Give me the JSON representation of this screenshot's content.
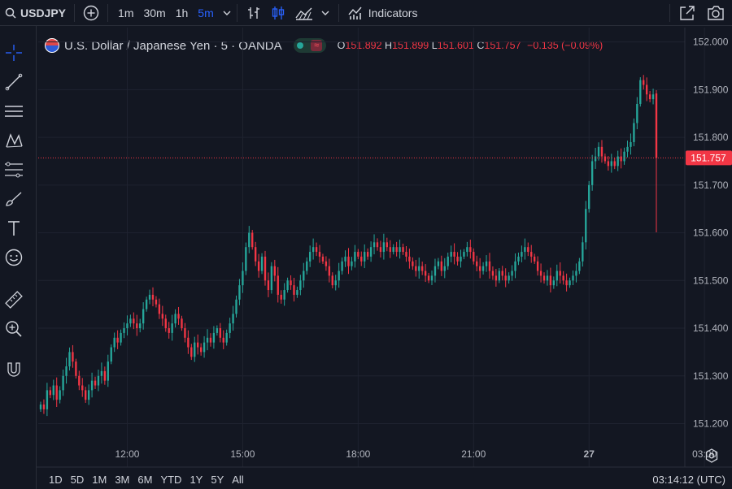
{
  "toolbar": {
    "symbol": "USDJPY",
    "timeframes": [
      "1m",
      "30m",
      "1h",
      "5m"
    ],
    "active_timeframe": "5m",
    "indicators_label": "Indicators"
  },
  "legend": {
    "title": "U.S. Dollar / Japanese Yen · 5 · OANDA",
    "o_key": "O",
    "o_val": "151.892",
    "h_key": "H",
    "h_val": "151.899",
    "l_key": "L",
    "l_val": "151.601",
    "c_key": "C",
    "c_val": "151.757",
    "change": "−0.135 (−0.09%)"
  },
  "bottom": {
    "ranges": [
      "1D",
      "5D",
      "1M",
      "3M",
      "6M",
      "YTD",
      "1Y",
      "5Y",
      "All"
    ],
    "clock": "03:14:12 (UTC)"
  },
  "colors": {
    "up": "#26a69a",
    "down": "#f23645",
    "accent": "#2962ff",
    "background": "#131722",
    "grid": "#1f2330"
  },
  "chart_data": {
    "type": "candlestick",
    "ylim": [
      151.16,
      152.03
    ],
    "y_ticks": [
      151.2,
      151.3,
      151.4,
      151.5,
      151.6,
      151.7,
      151.8,
      151.9,
      152.0
    ],
    "y_tick_labels": [
      "151.200",
      "151.300",
      "151.400",
      "151.500",
      "151.600",
      "151.700",
      "151.800",
      "151.900",
      "152.000"
    ],
    "x_ticks": [
      {
        "label": "12:00",
        "index": 27
      },
      {
        "label": "15:00",
        "index": 63
      },
      {
        "label": "18:00",
        "index": 99
      },
      {
        "label": "21:00",
        "index": 135
      },
      {
        "label": "27",
        "index": 171
      },
      {
        "label": "03:00",
        "index": 207
      }
    ],
    "last_price": 151.757,
    "last_price_label": "151.757",
    "close": [
      151.24,
      151.23,
      151.27,
      151.26,
      151.28,
      151.25,
      151.27,
      151.3,
      151.32,
      151.35,
      151.33,
      151.3,
      151.28,
      151.27,
      151.25,
      151.27,
      151.29,
      151.28,
      151.3,
      151.31,
      151.29,
      151.33,
      151.36,
      151.38,
      151.37,
      151.39,
      151.4,
      151.41,
      151.42,
      151.41,
      151.4,
      151.41,
      151.44,
      151.46,
      151.47,
      151.46,
      151.45,
      151.43,
      151.42,
      151.4,
      151.39,
      151.41,
      151.43,
      151.42,
      151.4,
      151.38,
      151.36,
      151.34,
      151.37,
      151.36,
      151.35,
      151.37,
      151.38,
      151.37,
      151.39,
      151.4,
      151.38,
      151.37,
      151.39,
      151.41,
      151.43,
      151.46,
      151.49,
      151.52,
      151.57,
      151.6,
      151.57,
      151.54,
      151.52,
      151.55,
      151.5,
      151.48,
      151.53,
      151.51,
      151.47,
      151.46,
      151.48,
      151.5,
      151.49,
      151.47,
      151.48,
      151.5,
      151.52,
      151.54,
      151.56,
      151.57,
      151.56,
      151.55,
      151.54,
      151.53,
      151.51,
      151.49,
      151.5,
      151.52,
      151.54,
      151.55,
      151.53,
      151.54,
      151.56,
      151.55,
      151.54,
      151.56,
      151.55,
      151.57,
      151.58,
      151.57,
      151.56,
      151.58,
      151.57,
      151.56,
      151.57,
      151.56,
      151.57,
      151.56,
      151.55,
      151.54,
      151.53,
      151.52,
      151.53,
      151.52,
      151.51,
      151.5,
      151.51,
      151.53,
      151.54,
      151.52,
      151.53,
      151.55,
      151.56,
      151.55,
      151.54,
      151.55,
      151.56,
      151.57,
      151.56,
      151.54,
      151.53,
      151.52,
      151.53,
      151.54,
      151.52,
      151.51,
      151.5,
      151.52,
      151.51,
      151.5,
      151.51,
      151.52,
      151.54,
      151.55,
      151.56,
      151.57,
      151.56,
      151.55,
      151.54,
      151.52,
      151.51,
      151.5,
      151.51,
      151.49,
      151.5,
      151.52,
      151.51,
      151.5,
      151.49,
      151.5,
      151.51,
      151.52,
      151.54,
      151.58,
      151.65,
      151.7,
      151.75,
      151.76,
      151.78,
      151.76,
      151.75,
      151.74,
      151.75,
      151.74,
      151.76,
      151.75,
      151.77,
      151.78,
      151.79,
      151.83,
      151.87,
      151.92,
      151.91,
      151.89,
      151.88,
      151.89,
      151.757
    ],
    "last_candle": {
      "open": 151.892,
      "high": 151.899,
      "low": 151.601,
      "close": 151.757
    }
  }
}
